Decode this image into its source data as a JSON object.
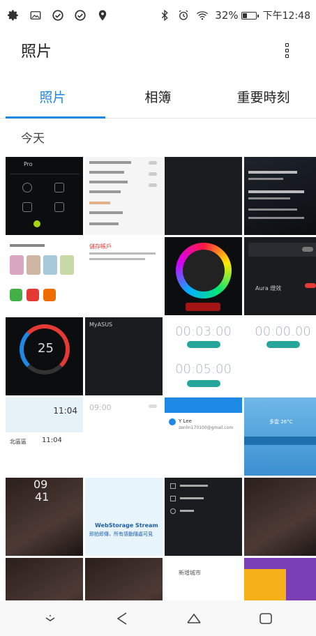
{
  "status_bar": {
    "left_icons": [
      "settings-gear-icon",
      "image-icon",
      "check-circle-icon",
      "check-circle-icon",
      "location-pin-icon"
    ],
    "right_icons": [
      "bluetooth-icon",
      "alarm-icon",
      "wifi-icon"
    ],
    "battery_percent": "32%",
    "time": "下午12:48"
  },
  "app_bar": {
    "title": "照片"
  },
  "tabs": [
    {
      "label": "照片",
      "active": true
    },
    {
      "label": "相簿",
      "active": false
    },
    {
      "label": "重要時刻",
      "active": false
    }
  ],
  "section_header": "今天",
  "thumbnails": {
    "t1": {
      "label_pro": "Pro"
    },
    "t5": {
      "title": "儲存帳戶"
    },
    "t8": {
      "text": "Aura 燈效"
    },
    "t9": {
      "time": "25"
    },
    "t10": {
      "label": "MyASUS"
    },
    "t11": {
      "timer_top": "00:03:00",
      "timer_mid": "00:05:00"
    },
    "t12": {
      "timer": "00:00.00"
    },
    "t13": {
      "time": "11:04",
      "city": "北區區",
      "time2": "11:04"
    },
    "t14": {
      "time": "09:00"
    },
    "t15": {
      "name": "Y Lee",
      "email": "zenlin170100@gmail.com"
    },
    "t16": {
      "temp": "多雲 26°C"
    },
    "t17": {
      "time1": "09",
      "time2": "41"
    },
    "t18": {
      "title": "WebStorage Stream",
      "subtitle": "即拍即傳，所有感動隨處可見"
    },
    "t22": {
      "add_city": "新增城市"
    }
  },
  "nav_bar": {
    "icons": [
      "down-chevron-icon",
      "back-triangle-icon",
      "home-icon",
      "recents-icon"
    ]
  }
}
